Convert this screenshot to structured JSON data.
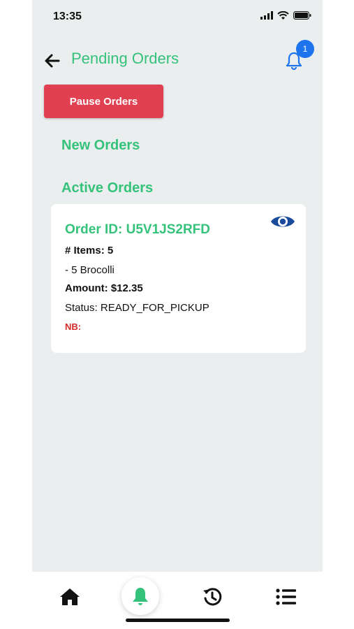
{
  "status_bar": {
    "time": "13:35"
  },
  "header": {
    "title": "Pending Orders",
    "notification_count": "1"
  },
  "actions": {
    "pause_label": "Pause Orders"
  },
  "sections": {
    "new_orders": "New Orders",
    "active_orders": "Active Orders"
  },
  "order": {
    "id_line": "Order ID: U5V1JS2RFD",
    "items_line": "# Items: 5",
    "item_detail": "- 5 Brocolli",
    "amount_line": "Amount: $12.35",
    "status_line": "Status: READY_FOR_PICKUP",
    "nb_line": "NB:"
  },
  "tabbar": {
    "items": [
      {
        "icon": "home-icon",
        "active": false
      },
      {
        "icon": "bell-icon",
        "active": true
      },
      {
        "icon": "history-icon",
        "active": false
      },
      {
        "icon": "list-icon",
        "active": false
      }
    ]
  },
  "colors": {
    "accent_green": "#35c27a",
    "pause_red": "#e0404f",
    "badge_blue": "#1e74ec",
    "eye_blue": "#1a4a9c",
    "background": "#ebeeef"
  }
}
